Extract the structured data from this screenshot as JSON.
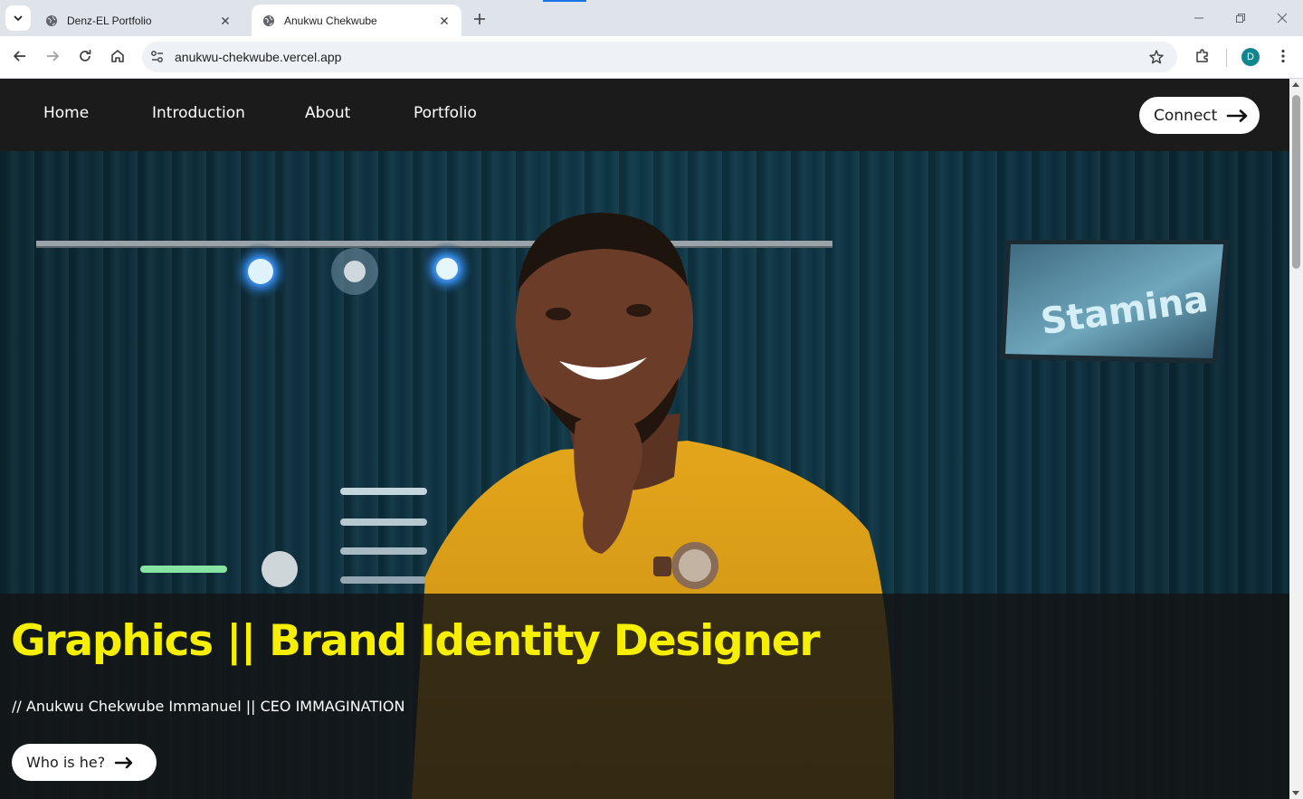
{
  "browser": {
    "tabs": [
      {
        "title": "Denz-EL Portfolio",
        "active": false
      },
      {
        "title": "Anukwu Chekwube",
        "active": true
      }
    ],
    "url": "anukwu-chekwube.vercel.app",
    "profile_initial": "D",
    "accent": "#1a73e8"
  },
  "nav": {
    "links": [
      "Home",
      "Introduction",
      "About",
      "Portfolio"
    ],
    "cta_label": "Connect"
  },
  "hero": {
    "screen_sign": "Stamina",
    "headline": "Graphics || Brand Identity Designer",
    "subline": "// Anukwu Chekwube Immanuel || CEO IMMAGINATION",
    "cta_label": "Who is he?",
    "headline_color": "#f6f000"
  }
}
